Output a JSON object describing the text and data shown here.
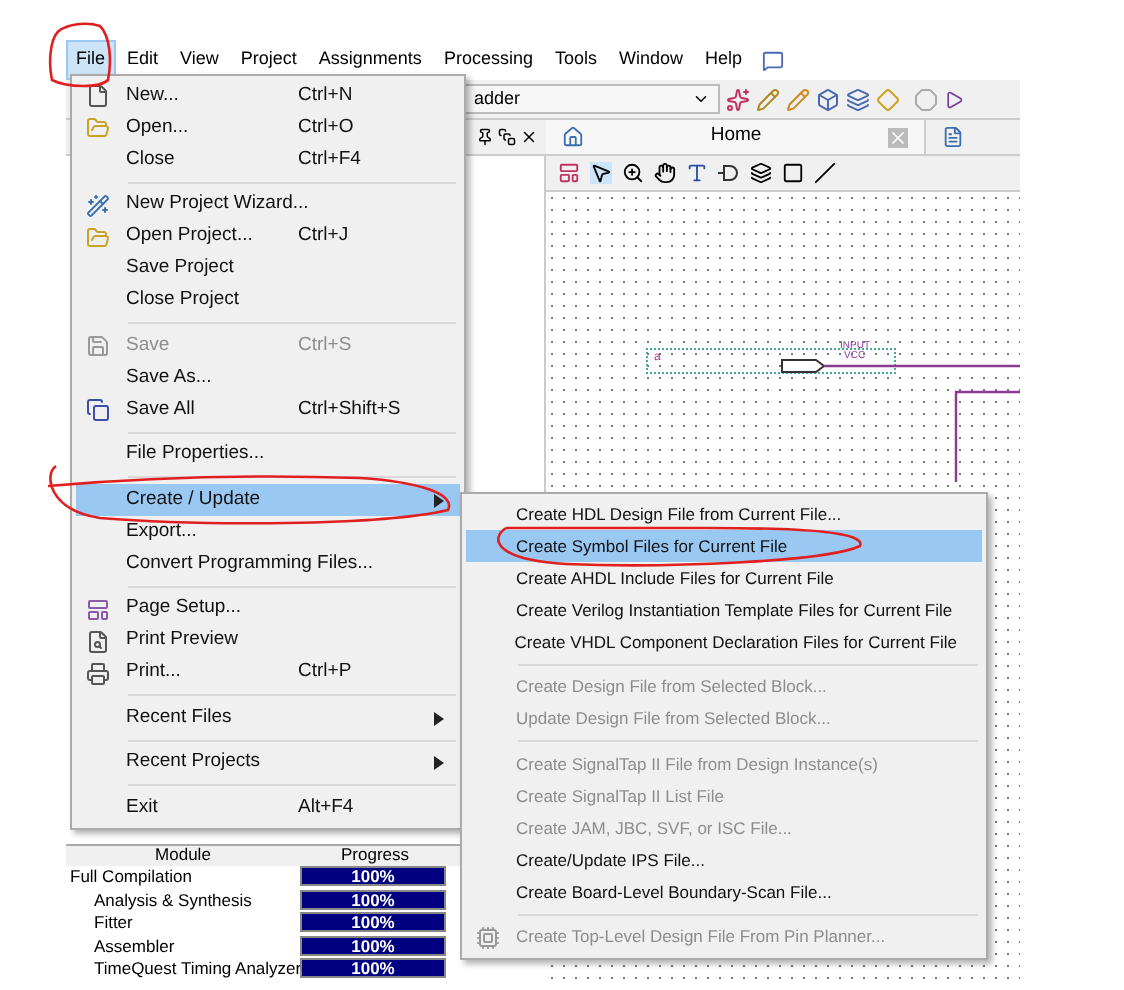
{
  "menu_bar": [
    {
      "label": "File",
      "selected": true
    },
    {
      "label": "Edit",
      "selected": false
    },
    {
      "label": "View",
      "selected": false
    },
    {
      "label": "Project",
      "selected": false
    },
    {
      "label": "Assignments",
      "selected": false
    },
    {
      "label": "Processing",
      "selected": false
    },
    {
      "label": "Tools",
      "selected": false
    },
    {
      "label": "Window",
      "selected": false
    },
    {
      "label": "Help",
      "selected": false
    }
  ],
  "toolbar": {
    "project_combo": "adder"
  },
  "document_tab": {
    "label": "Home"
  },
  "canvas": {
    "pin_name": "a",
    "pin_type": "INPUT",
    "pin_default": "VCC"
  },
  "compilation": {
    "columns": [
      "Module",
      "Progress"
    ],
    "rows": [
      {
        "name": "Full Compilation",
        "progress": "100%",
        "level": 1,
        "indented": false
      },
      {
        "name": "Analysis & Synthesis",
        "progress": "100%",
        "level": 1,
        "indented": true
      },
      {
        "name": "Fitter",
        "progress": "100%",
        "level": 1,
        "indented": true
      },
      {
        "name": "Assembler",
        "progress": "100%",
        "level": 1,
        "indented": true
      },
      {
        "name": "TimeQuest Timing Analyzer",
        "progress": "100%",
        "level": 1,
        "indented": true
      }
    ]
  },
  "file_menu": [
    {
      "kind": "item",
      "label": "New...",
      "shortcut": "Ctrl+N",
      "disabled": false,
      "selected": false
    },
    {
      "kind": "item",
      "label": "Open...",
      "shortcut": "Ctrl+O",
      "disabled": false,
      "selected": false
    },
    {
      "kind": "item",
      "label": "Close",
      "shortcut": "Ctrl+F4",
      "disabled": false,
      "selected": false
    },
    {
      "kind": "separator"
    },
    {
      "kind": "item",
      "label": "New Project Wizard...",
      "disabled": false,
      "selected": false
    },
    {
      "kind": "item",
      "label": "Open Project...",
      "shortcut": "Ctrl+J",
      "disabled": false,
      "selected": false
    },
    {
      "kind": "item",
      "label": "Save Project",
      "disabled": false,
      "selected": false
    },
    {
      "kind": "item",
      "label": "Close Project",
      "disabled": false,
      "selected": false
    },
    {
      "kind": "separator"
    },
    {
      "kind": "item",
      "label": "Save",
      "shortcut": "Ctrl+S",
      "disabled": true,
      "selected": false
    },
    {
      "kind": "item",
      "label": "Save As...",
      "disabled": false,
      "selected": false
    },
    {
      "kind": "item",
      "label": "Save All",
      "shortcut": "Ctrl+Shift+S",
      "disabled": false,
      "selected": false
    },
    {
      "kind": "separator"
    },
    {
      "kind": "item",
      "label": "File Properties...",
      "disabled": false,
      "selected": false
    },
    {
      "kind": "separator"
    },
    {
      "kind": "item",
      "label": "Create / Update",
      "submenu": true,
      "disabled": false,
      "selected": true
    },
    {
      "kind": "item",
      "label": "Export...",
      "disabled": false,
      "selected": false
    },
    {
      "kind": "item",
      "label": "Convert Programming Files...",
      "disabled": false,
      "selected": false
    },
    {
      "kind": "separator"
    },
    {
      "kind": "item",
      "label": "Page Setup...",
      "disabled": false,
      "selected": false
    },
    {
      "kind": "item",
      "label": "Print Preview",
      "disabled": false,
      "selected": false
    },
    {
      "kind": "item",
      "label": "Print...",
      "shortcut": "Ctrl+P",
      "disabled": false,
      "selected": false
    },
    {
      "kind": "separator"
    },
    {
      "kind": "item",
      "label": "Recent Files",
      "submenu": true,
      "disabled": false,
      "selected": false
    },
    {
      "kind": "separator"
    },
    {
      "kind": "item",
      "label": "Recent Projects",
      "submenu": true,
      "disabled": false,
      "selected": false
    },
    {
      "kind": "separator"
    },
    {
      "kind": "item",
      "label": "Exit",
      "shortcut": "Alt+F4",
      "disabled": false,
      "selected": false
    }
  ],
  "create_update_menu": [
    {
      "kind": "item",
      "label": "Create HDL Design File from Current File...",
      "disabled": false,
      "selected": false
    },
    {
      "kind": "item",
      "label": "Create Symbol Files for Current File",
      "disabled": false,
      "selected": true
    },
    {
      "kind": "item",
      "label": "Create AHDL Include Files for Current File",
      "disabled": false,
      "selected": false
    },
    {
      "kind": "item",
      "label": "Create Verilog Instantiation Template Files for Current File",
      "disabled": false,
      "selected": false
    },
    {
      "kind": "item",
      "label": "Create VHDL Component Declaration Files for Current File",
      "disabled": false,
      "selected": false
    },
    {
      "kind": "separator"
    },
    {
      "kind": "item",
      "label": "Create Design File from Selected Block...",
      "disabled": true,
      "selected": false
    },
    {
      "kind": "item",
      "label": "Update Design File from Selected Block...",
      "disabled": true,
      "selected": false
    },
    {
      "kind": "separator"
    },
    {
      "kind": "item",
      "label": "Create SignalTap II File from Design Instance(s)",
      "disabled": true,
      "selected": false
    },
    {
      "kind": "item",
      "label": "Create SignalTap II List File",
      "disabled": true,
      "selected": false
    },
    {
      "kind": "item",
      "label": "Create JAM, JBC, SVF, or ISC File...",
      "disabled": true,
      "selected": false
    },
    {
      "kind": "item",
      "label": "Create/Update IPS File...",
      "disabled": false,
      "selected": false
    },
    {
      "kind": "item",
      "label": "Create Board-Level Boundary-Scan File...",
      "disabled": false,
      "selected": false
    },
    {
      "kind": "separator"
    },
    {
      "kind": "item",
      "label": "Create Top-Level Design File From Pin Planner...",
      "disabled": true,
      "selected": false
    }
  ]
}
